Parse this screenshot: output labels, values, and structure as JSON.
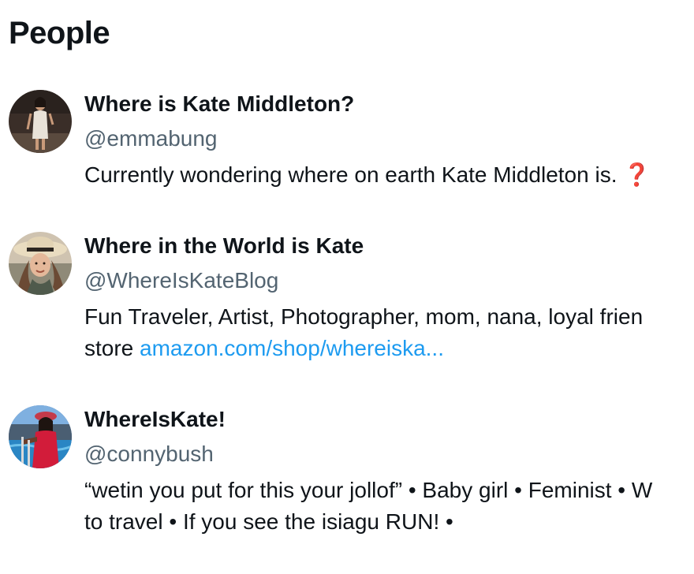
{
  "section": {
    "title": "People"
  },
  "people": [
    {
      "name": "Where is Kate Middleton?",
      "handle": "@emmabung",
      "bio_line1": "Currently wondering where on earth Kate Middleton is.",
      "bio_emoji": "❓",
      "avatar": "avatar-emmabung"
    },
    {
      "name": "Where in the World is Kate",
      "handle": "@WhereIsKateBlog",
      "bio_line1": "Fun Traveler, Artist, Photographer, mom, nana, loyal frien",
      "bio_line2_prefix": "store ",
      "bio_link": "amazon.com/shop/whereiska...",
      "avatar": "avatar-whereiskateblog"
    },
    {
      "name": "WhereIsKate!",
      "handle": "@connybush",
      "bio_line1": "“wetin you put for this your jollof” • Baby girl • Feminist • W",
      "bio_line2": "to travel • If you see the isiagu RUN! •",
      "avatar": "avatar-connybush"
    }
  ],
  "colors": {
    "text": "#0f1419",
    "secondary": "#536471",
    "link": "#1d9bf0",
    "emoji_red": "#d0121b"
  }
}
